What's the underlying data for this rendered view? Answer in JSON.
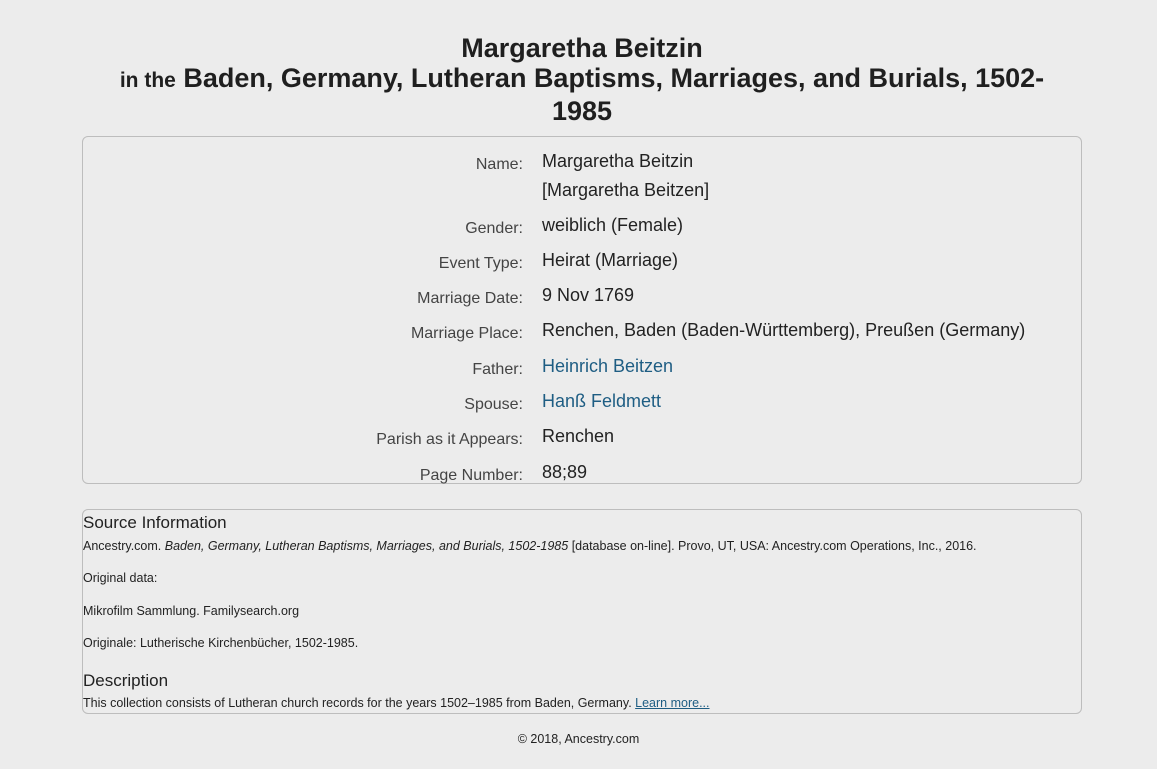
{
  "header": {
    "name": "Margaretha Beitzin",
    "in_the": "in the",
    "collection": "Baden, Germany, Lutheran Baptisms, Marriages, and Burials, 1502-1985"
  },
  "record": [
    {
      "label": "Name:",
      "value": "Margaretha Beitzin",
      "value2": "[Margaretha Beitzen]",
      "is_link": false
    },
    {
      "label": "Gender:",
      "value": "weiblich (Female)",
      "is_link": false
    },
    {
      "label": "Event Type:",
      "value": "Heirat (Marriage)",
      "is_link": false
    },
    {
      "label": "Marriage Date:",
      "value": "9 Nov 1769",
      "is_link": false
    },
    {
      "label": "Marriage Place:",
      "value": "Renchen, Baden (Baden-Württemberg), Preußen (Germany)",
      "is_link": false
    },
    {
      "label": "Father:",
      "value": "Heinrich Beitzen",
      "is_link": true
    },
    {
      "label": "Spouse:",
      "value": "Hanß Feldmett",
      "is_link": true
    },
    {
      "label": "Parish as it Appears:",
      "value": "Renchen",
      "is_link": false
    },
    {
      "label": "Page Number:",
      "value": "88;89",
      "is_link": false
    }
  ],
  "source": {
    "heading": "Source Information",
    "citation_prefix": "Ancestry.com.",
    "citation_title": "Baden, Germany, Lutheran Baptisms, Marriages, and Burials, 1502-1985",
    "citation_suffix": "[database on-line]. Provo, UT, USA: Ancestry.com Operations, Inc., 2016.",
    "original_data_label": "Original data:",
    "original_line1": "Mikrofilm Sammlung. Familysearch.org",
    "original_line2": "Originale: Lutherische Kirchenbücher, 1502-1985."
  },
  "description": {
    "heading": "Description",
    "text": "This collection consists of Lutheran church records for the years 1502–1985 from Baden, Germany.",
    "learn_more": "Learn more..."
  },
  "footer": {
    "copyright": "© 2018, Ancestry.com"
  }
}
